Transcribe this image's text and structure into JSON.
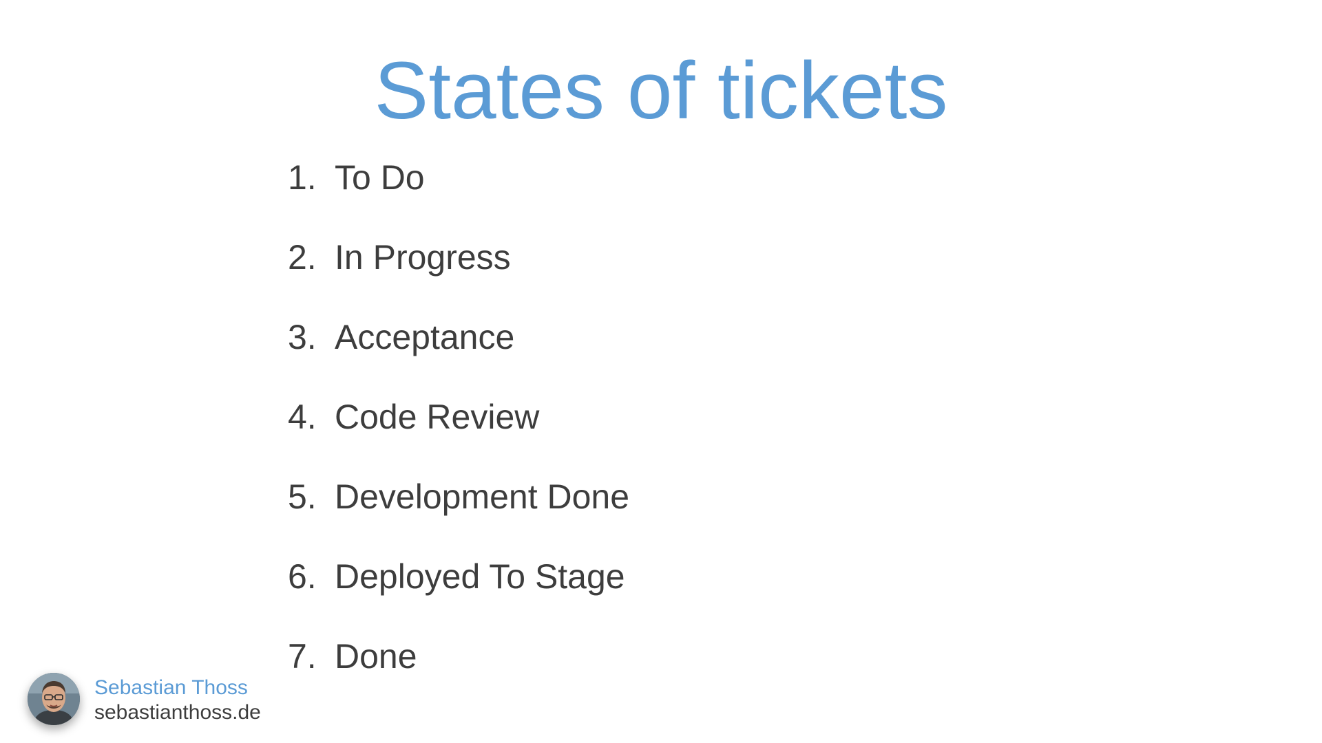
{
  "slide": {
    "title": "States of tickets",
    "states": [
      {
        "number": "1.",
        "label": "To Do"
      },
      {
        "number": "2.",
        "label": "In Progress"
      },
      {
        "number": "3.",
        "label": "Acceptance"
      },
      {
        "number": "4.",
        "label": "Code Review"
      },
      {
        "number": "5.",
        "label": "Development Done"
      },
      {
        "number": "6.",
        "label": "Deployed To Stage"
      },
      {
        "number": "7.",
        "label": "Done"
      }
    ]
  },
  "author": {
    "name": "Sebastian Thoss",
    "website": "sebastianthoss.de",
    "avatar_icon": "avatar-photo"
  },
  "colors": {
    "accent": "#5b9bd5",
    "text": "#3d3d3d",
    "background": "#ffffff"
  }
}
